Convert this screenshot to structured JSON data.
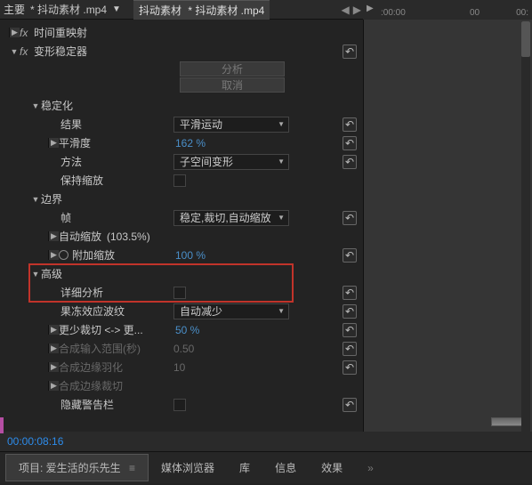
{
  "topbar": {
    "main": "主要",
    "file1": "* 抖动素材 .mp4",
    "breadcrumb": "抖动素材",
    "file2": "* 抖动素材 .mp4"
  },
  "timeline": {
    "t1": ":00:00",
    "t2": "00",
    "t3": "00:"
  },
  "effects": {
    "timeRemap": "时间重映射",
    "warpStab": "变形稳定器",
    "analyzeBtn": "分析",
    "cancelBtn": "取消",
    "stabilize": "稳定化",
    "result": "结果",
    "resultVal": "平滑运动",
    "smoothness": "平滑度",
    "smoothnessVal": "162 %",
    "method": "方法",
    "methodVal": "子空间变形",
    "preserveScale": "保持缩放",
    "borders": "边界",
    "framing": "帧",
    "framingVal": "稳定,裁切,自动缩放",
    "autoscale": "自动缩放",
    "autoscalePct": "(103.5%)",
    "additionalScale": "附加缩放",
    "additionalScaleVal": "100 %",
    "advanced": "高级",
    "detailedAnalysis": "详细分析",
    "rollingShutter": "果冻效应波纹",
    "rollingShutterVal": "自动减少",
    "lessMore": "更少裁切 <-> 更...",
    "lessMoreVal": "50 %",
    "synthInput": "合成输入范围(秒)",
    "synthInputVal": "0.50",
    "synthEdge": "合成边缘羽化",
    "synthEdgeVal": "10",
    "synthEdgeCrop": "合成边缘裁切",
    "hideWarning": "隐藏警告栏"
  },
  "timecode": "00:00:08:16",
  "bottomTabs": {
    "project": "项目: 爱生活的乐先生",
    "mediaBrowser": "媒体浏览器",
    "library": "库",
    "info": "信息",
    "effects": "效果"
  }
}
